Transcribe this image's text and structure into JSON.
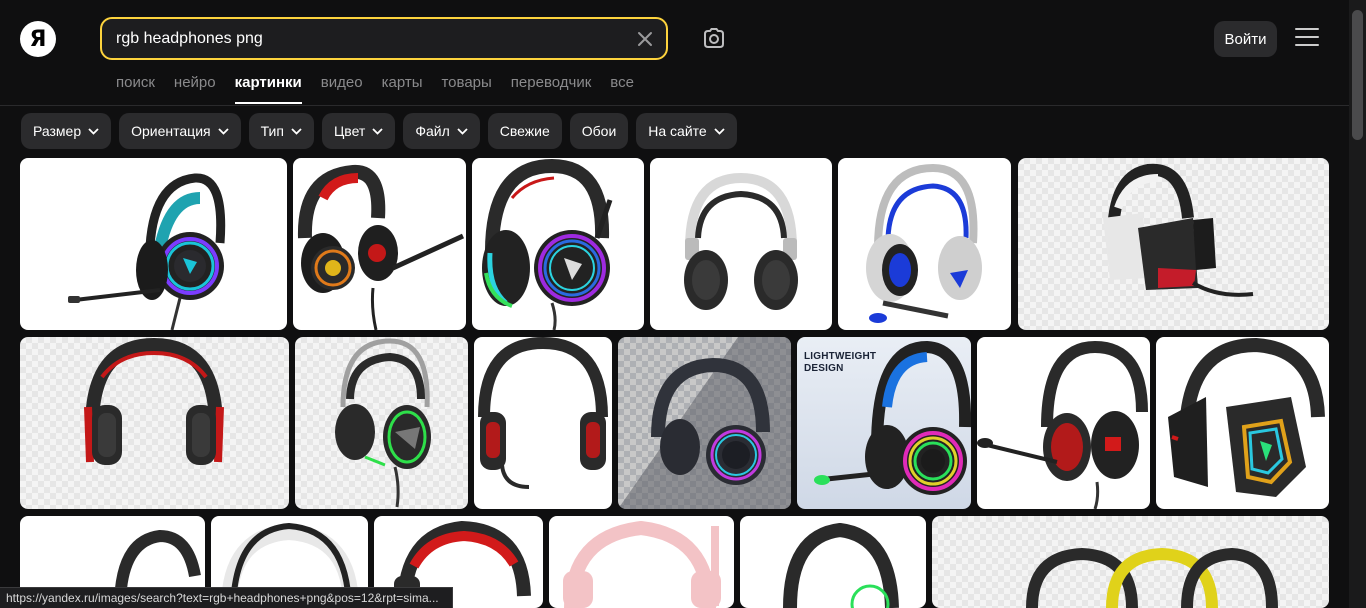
{
  "logo": {
    "letter": "Я"
  },
  "search": {
    "value": "rgb headphones png",
    "placeholder": ""
  },
  "header": {
    "login_label": "Войти"
  },
  "tabs": [
    {
      "label": "поиск",
      "active": false
    },
    {
      "label": "нейро",
      "active": false
    },
    {
      "label": "картинки",
      "active": true
    },
    {
      "label": "видео",
      "active": false
    },
    {
      "label": "карты",
      "active": false
    },
    {
      "label": "товары",
      "active": false
    },
    {
      "label": "переводчик",
      "active": false
    },
    {
      "label": "все",
      "active": false
    }
  ],
  "filters": [
    {
      "label": "Размер",
      "dropdown": true
    },
    {
      "label": "Ориентация",
      "dropdown": true
    },
    {
      "label": "Тип",
      "dropdown": true
    },
    {
      "label": "Цвет",
      "dropdown": true
    },
    {
      "label": "Файл",
      "dropdown": true
    },
    {
      "label": "Свежие",
      "dropdown": false
    },
    {
      "label": "Обои",
      "dropdown": false
    },
    {
      "label": "На сайте",
      "dropdown": true
    }
  ],
  "ad_tile": {
    "title_line1": "LIGHTWEIGHT",
    "title_line2": "DESIGN"
  },
  "statusbar": {
    "url": "https://yandex.ru/images/search?text=rgb+headphones+png&pos=12&rpt=sima..."
  },
  "colors": {
    "accent_yellow": "#fdd33d",
    "background": "#0f0f10",
    "chip": "#2b2b2d"
  }
}
